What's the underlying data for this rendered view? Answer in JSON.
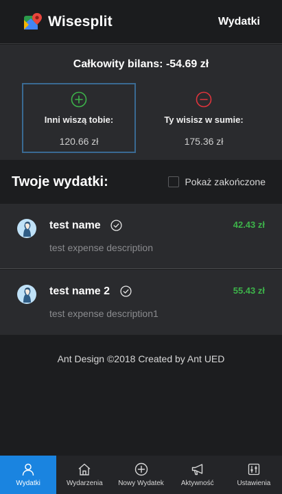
{
  "header": {
    "brand": "Wisesplit",
    "logo_icon": "map-pin-logo-icon",
    "nav_link": "Wydatki"
  },
  "balance": {
    "title": "Całkowity bilans: -54.69 zł",
    "owed_to_you": {
      "label": "Inni wiszą tobie:",
      "value": "120.66 zł",
      "icon": "plus-circle-icon",
      "color": "#3db34a"
    },
    "you_owe": {
      "label": "Ty wisisz w sumie:",
      "value": "175.36 zł",
      "icon": "minus-circle-icon",
      "color": "#e0343c"
    }
  },
  "expenses_section": {
    "title": "Twoje wydatki:",
    "show_finished_label": "Pokaż zakończone",
    "show_finished_checked": false
  },
  "expenses": [
    {
      "name": "test name",
      "description": "test expense description",
      "amount": "42.43 zł",
      "status_icon": "check-circle-icon"
    },
    {
      "name": "test name 2",
      "description": "test expense description1",
      "amount": "55.43 zł",
      "status_icon": "check-circle-icon"
    }
  ],
  "footer": {
    "text": "Ant Design ©2018 Created by Ant UED"
  },
  "bottom_nav": {
    "items": [
      {
        "label": "Wydatki",
        "icon": "user-icon",
        "active": true
      },
      {
        "label": "Wydarzenia",
        "icon": "home-icon",
        "active": false
      },
      {
        "label": "Nowy Wydatek",
        "icon": "plus-circle-icon",
        "active": false
      },
      {
        "label": "Aktywność",
        "icon": "megaphone-icon",
        "active": false
      },
      {
        "label": "Ustawienia",
        "icon": "sliders-icon",
        "active": false
      }
    ]
  },
  "colors": {
    "accent": "#1a84e0",
    "positive": "#3db34a",
    "negative": "#e0343c"
  }
}
